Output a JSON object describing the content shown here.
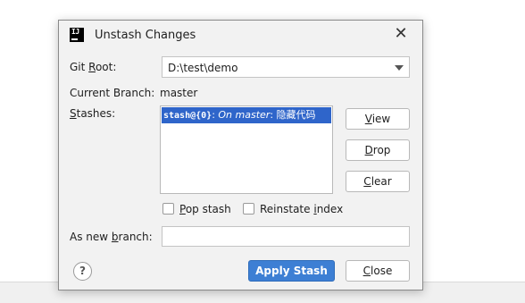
{
  "dialog": {
    "title": "Unstash Changes",
    "app_icon_text": "IJ"
  },
  "git_root": {
    "label_pre": "Git ",
    "label_key": "R",
    "label_post": "oot:",
    "value": "D:\\test\\demo"
  },
  "current_branch": {
    "label": "Current Branch:",
    "value": "master"
  },
  "stashes": {
    "label_key": "S",
    "label_post": "tashes:",
    "items": [
      {
        "ref": "stash@{0}",
        "sep": ": ",
        "branch": "On master",
        "message": ": 隐藏代码"
      }
    ]
  },
  "buttons": {
    "view_key": "V",
    "view_rest": "iew",
    "drop_key": "D",
    "drop_rest": "rop",
    "clear_key": "C",
    "clear_rest": "lear",
    "apply": "Apply Stash",
    "close_key": "C",
    "close_rest": "lose"
  },
  "options": {
    "pop_key": "P",
    "pop_rest": "op stash",
    "reinstate_pre": "Reinstate ",
    "reinstate_key": "i",
    "reinstate_post": "ndex"
  },
  "new_branch": {
    "label_pre": "As new ",
    "label_key": "b",
    "label_post": "ranch:",
    "value": ""
  },
  "help": {
    "symbol": "?"
  },
  "colors": {
    "selection": "#2f65ca",
    "primary_button": "#3d7fd4",
    "dialog_bg": "#f2f2f2"
  }
}
